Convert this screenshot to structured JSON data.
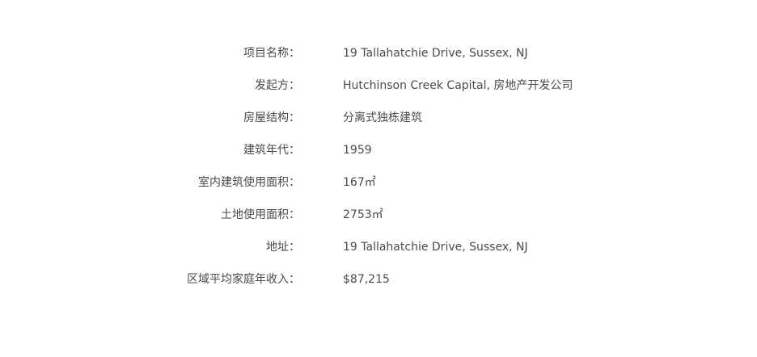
{
  "details": [
    {
      "label": "项目名称：",
      "value": "19 Tallahatchie Drive, Sussex, NJ"
    },
    {
      "label": "发起方：",
      "value": "Hutchinson Creek Capital, 房地产开发公司"
    },
    {
      "label": "房屋结构：",
      "value": "分离式独栋建筑"
    },
    {
      "label": "建筑年代：",
      "value": "1959"
    },
    {
      "label": "室内建筑使用面积：",
      "value": "167㎡"
    },
    {
      "label": "土地使用面积：",
      "value": "2753㎡"
    },
    {
      "label": "地址：",
      "value": "19 Tallahatchie Drive, Sussex, NJ"
    },
    {
      "label": "区域平均家庭年收入：",
      "value": "$87,215"
    }
  ]
}
